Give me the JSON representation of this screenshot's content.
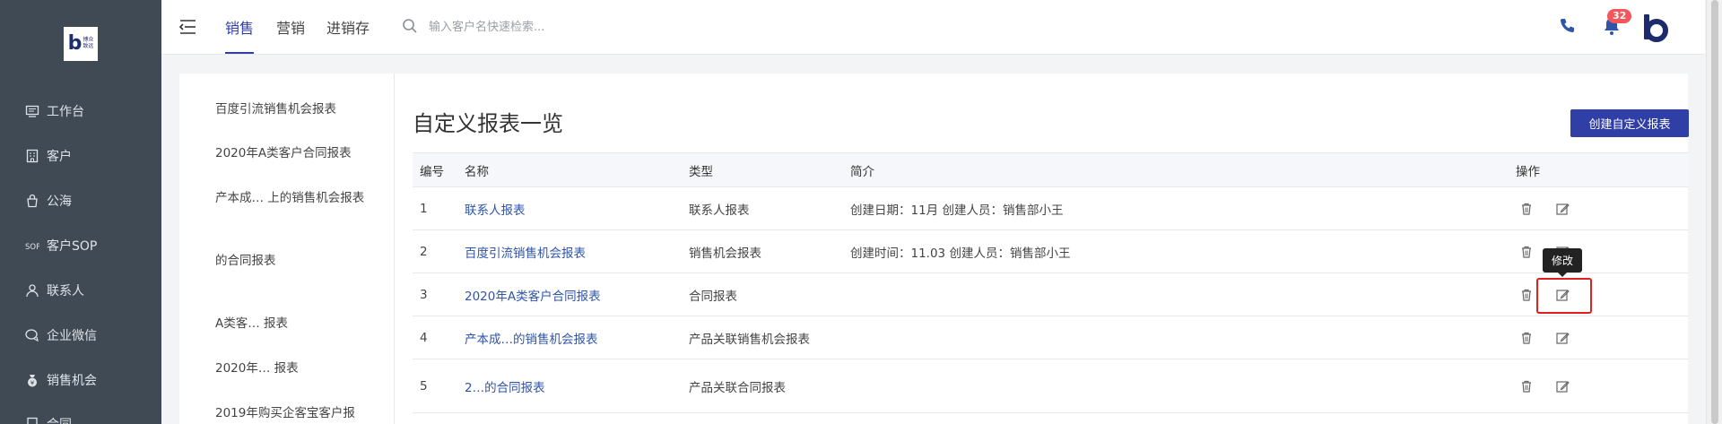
{
  "sidebar": {
    "logo_text": "博众\n致远",
    "items": [
      {
        "label": "工作台",
        "icon": "desktop-icon"
      },
      {
        "label": "客户",
        "icon": "building-icon"
      },
      {
        "label": "公海",
        "icon": "bag-icon"
      },
      {
        "label": "客户SOP",
        "icon": "sop-icon"
      },
      {
        "label": "联系人",
        "icon": "person-icon"
      },
      {
        "label": "企业微信",
        "icon": "chat-icon"
      },
      {
        "label": "销售机会",
        "icon": "moneybag-icon"
      },
      {
        "label": "合同",
        "icon": "contract-icon"
      }
    ]
  },
  "header": {
    "tabs": [
      "销售",
      "营销",
      "进销存"
    ],
    "active_tab": "销售",
    "search_placeholder": "输入客户名快速检索...",
    "notification_count": "32"
  },
  "report_list": [
    "百度引流销售机会报表",
    "2020年A类客户合同报表",
    "产本成… 上的销售机会报表",
    "的合同报表",
    "A类客… 报表",
    "2020年… 报表",
    "2019年购买企客宝客户报"
  ],
  "main": {
    "title": "自定义报表一览",
    "create_button": "创建自定义报表",
    "columns": [
      "编号",
      "名称",
      "类型",
      "简介",
      "操作"
    ],
    "rows": [
      {
        "id": "1",
        "name": "联系人报表",
        "type": "联系人报表",
        "desc": "创建日期：11月 创建人员：销售部小王"
      },
      {
        "id": "2",
        "name": "百度引流销售机会报表",
        "type": "销售机会报表",
        "desc": "创建时间：11.03 创建人员：销售部小王"
      },
      {
        "id": "3",
        "name": "2020年A类客户合同报表",
        "type": "合同报表",
        "desc": ""
      },
      {
        "id": "4",
        "name": "产本成…的销售机会报表",
        "type": "产品关联销售机会报表",
        "desc": ""
      },
      {
        "id": "5",
        "name": "2…的合同报表",
        "type": "产品关联合同报表",
        "desc": ""
      }
    ],
    "tooltip": "修改"
  },
  "colors": {
    "sidebar_bg": "#3f4a55",
    "accent": "#2f3fa6",
    "link": "#2f54a8",
    "highlight_border": "#e02020"
  }
}
